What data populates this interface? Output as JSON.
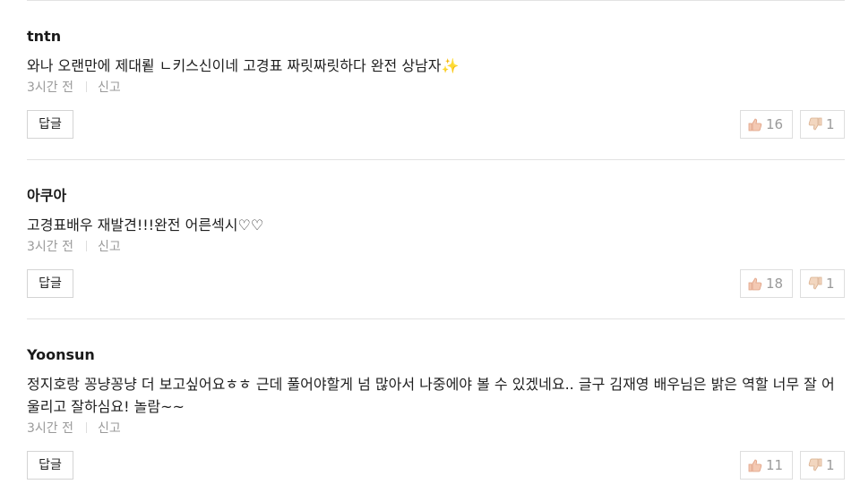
{
  "comments": [
    {
      "author": "tntn",
      "text": "와나 오랜만에 제대룉 ㄴ키스신이네 고경표 짜릿짜릿하다 완전 상남자",
      "emoji": "✨",
      "time": "3시간 전",
      "report_label": "신고",
      "reply_label": "답글",
      "likes": "16",
      "dislikes": "1"
    },
    {
      "author": "아쿠아",
      "text": "고경표배우 재발견!!!완전 어른섹시♡♡",
      "emoji": "",
      "time": "3시간 전",
      "report_label": "신고",
      "reply_label": "답글",
      "likes": "18",
      "dislikes": "1"
    },
    {
      "author": "Yoonsun",
      "text": "정지호랑 꽁냥꽁냥 더 보고싶어요ㅎㅎ 근데 풀어야할게 넘 많아서 나중에야 볼 수 있겠네요.. 글구 김재영 배우님은 밝은 역할 너무 잘 어울리고 잘하심요! 놀람~~",
      "emoji": "",
      "time": "3시간 전",
      "report_label": "신고",
      "reply_label": "답글",
      "likes": "11",
      "dislikes": "1"
    }
  ],
  "icons": {
    "like": "thumbs-up-icon",
    "dislike": "thumbs-down-icon"
  },
  "colors": {
    "thumb_up_fill": "#f4c9b3",
    "thumb_up_stroke": "#e0a184",
    "thumb_down_fill": "#f2d6bf",
    "thumb_down_stroke": "#d9b08f",
    "sparkle": "#f2c94c"
  }
}
